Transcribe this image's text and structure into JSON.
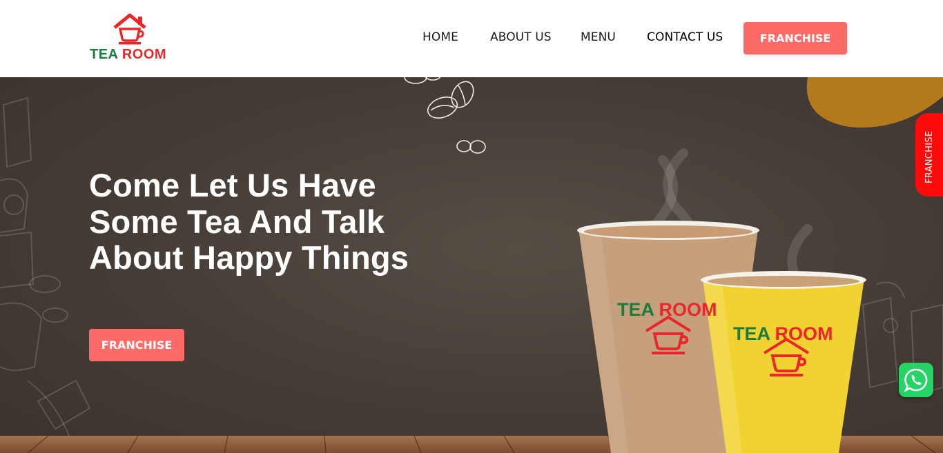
{
  "header": {
    "logo": {
      "word1": "TEA",
      "word2": "ROOM"
    },
    "nav": [
      {
        "label": "HOME"
      },
      {
        "label": "ABOUT US"
      },
      {
        "label": "MENU"
      },
      {
        "label": "CONTACT US"
      }
    ],
    "franchise_button": "FRANCHISE"
  },
  "hero": {
    "title": "Come Let Us Have Some Tea And Talk About Happy Things",
    "franchise_button": "FRANCHISE",
    "cup_brand_word1": "TEA",
    "cup_brand_word2": "ROOM"
  },
  "side_tab": {
    "label": "FRANCHISE"
  },
  "whatsapp": {
    "icon": "whatsapp-icon"
  },
  "colors": {
    "accent": "#fd6b68",
    "side_tab": "#ff0a0a",
    "brand_green": "#1e7b3f",
    "brand_red": "#e8272a",
    "hero_bg": "#453c35",
    "whatsapp": "#25d366"
  }
}
